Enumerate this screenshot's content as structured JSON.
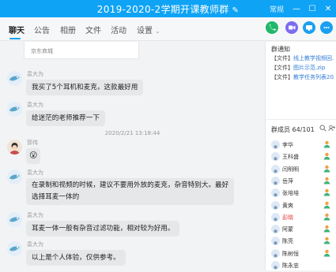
{
  "window": {
    "title": "2019-2020-2学期开课教师群",
    "title_edit_icon": "✎",
    "more_label": "常规",
    "min_icon": "—",
    "max_icon": "☐",
    "close_icon": "✕"
  },
  "tabs": [
    {
      "label": "聊天"
    },
    {
      "label": "公告"
    },
    {
      "label": "相册"
    },
    {
      "label": "文件"
    },
    {
      "label": "活动"
    },
    {
      "label": "设置"
    }
  ],
  "tab_chevron": "⌄",
  "toolbar_icons": [
    "phone-icon",
    "video-icon",
    "share-screen-icon",
    "more-icon"
  ],
  "colors": {
    "accent": "#0fa3f5",
    "green": "#21b86b",
    "purple": "#7b6cf0",
    "blue": "#1aa0f0",
    "red": "#e0353b"
  },
  "chat": {
    "card_text": "京东商城",
    "timestamp": "2020/2/21 13:18:44",
    "messages": [
      {
        "sender": "袁大为",
        "text": "我买了5个耳机和麦克，这款最好用"
      },
      {
        "sender": "袁大为",
        "text": "给迷茫的老师推荐一下"
      },
      {
        "sender": "郭伟",
        "text": "😮"
      },
      {
        "sender": "袁大为",
        "lines": [
          "在录制和视频的时候，建议不要用外放的麦克，杂音特别大。最好",
          "选择耳麦一体的"
        ]
      },
      {
        "sender": "袁大为",
        "text": "耳麦一体一般有杂音过滤功能，相对较为好用。"
      },
      {
        "sender": "袁大为",
        "text": "以上是个人体验，仅供参考。"
      }
    ]
  },
  "right_panel": {
    "notice_title": "群通知",
    "notices": [
      {
        "tag": "【文件】",
        "text": "线上教学视频回..."
      },
      {
        "tag": "【文件】",
        "text": "图片示范.zip"
      },
      {
        "tag": "【文件】",
        "text": "教学任务列表20..."
      }
    ],
    "members_title": "群成员 64/101",
    "members": [
      {
        "name": "李华",
        "red": false
      },
      {
        "name": "王科盛",
        "red": false
      },
      {
        "name": "闫明明",
        "red": false
      },
      {
        "name": "岳萍",
        "red": false
      },
      {
        "name": "张培培",
        "red": false
      },
      {
        "name": "黄爽",
        "red": false
      },
      {
        "name": "彭晓",
        "red": true
      },
      {
        "name": "阿蒙",
        "red": false
      },
      {
        "name": "陈亮",
        "red": false
      },
      {
        "name": "陈树恒",
        "red": false
      },
      {
        "name": "陈永忠",
        "red": false
      }
    ]
  }
}
